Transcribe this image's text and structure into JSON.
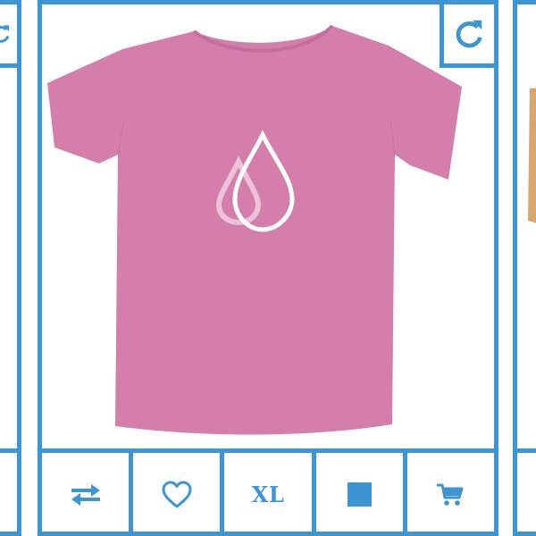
{
  "product_card": {
    "image": {
      "icon": "tshirt-with-water-drop-logo",
      "shirt_color": "#d47eab"
    },
    "refresh": {
      "icon": "refresh-icon"
    },
    "actions": [
      {
        "id": "compare",
        "icon": "swap-arrows-icon"
      },
      {
        "id": "wishlist",
        "icon": "heart-icon"
      },
      {
        "id": "size",
        "label": "XL"
      },
      {
        "id": "color",
        "icon": "color-swatch",
        "color": "#3f94d2"
      },
      {
        "id": "cart",
        "icon": "cart-icon"
      }
    ]
  },
  "theme": {
    "accent": "#3f94d2",
    "background": "#ffffff"
  }
}
